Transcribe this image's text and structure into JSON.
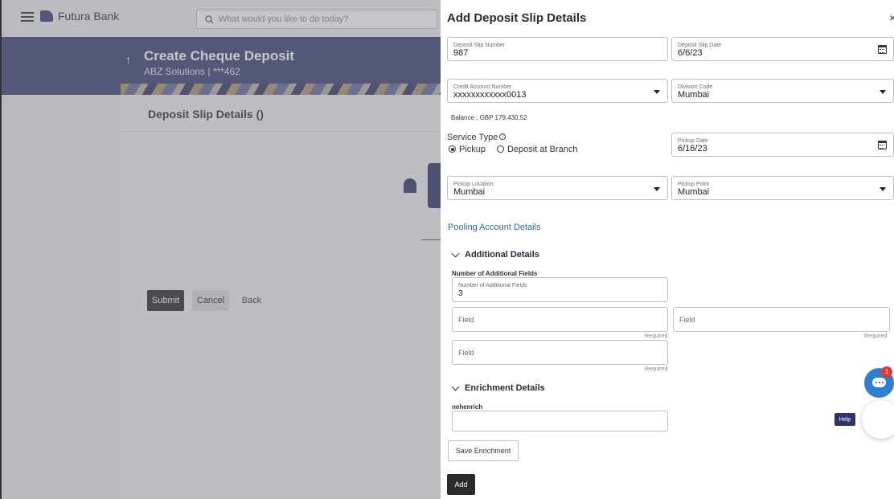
{
  "app": {
    "brand": "Futura Bank",
    "search_placeholder": "What would you like to do today?",
    "page_title": "Create Cheque Deposit",
    "page_subtitle": "ABZ Solutions | ***462",
    "card_title": "Deposit Slip Details ()",
    "buttons": {
      "submit": "Submit",
      "cancel": "Cancel",
      "back": "Back"
    }
  },
  "drawer": {
    "title": "Add Deposit Slip Details",
    "close": "×",
    "deposit_slip_number": {
      "label": "Deposit Slip Number",
      "value": "987"
    },
    "deposit_slip_date": {
      "label": "Deposit Slip Date",
      "value": "6/6/23"
    },
    "credit_account_number": {
      "label": "Credit Account Number",
      "value": "xxxxxxxxxxxx0013"
    },
    "division_code": {
      "label": "Division Code",
      "value": "Mumbai"
    },
    "balance": "Balance : GBP 179,430.52",
    "service_type": {
      "label": "Service Type",
      "info": "i",
      "options": [
        "Pickup",
        "Deposit at Branch"
      ],
      "selected": "Pickup"
    },
    "pickup_date": {
      "label": "Pickup Date",
      "value": "6/16/23"
    },
    "pickup_location": {
      "label": "Pickup Location",
      "value": "Mumbai"
    },
    "pickup_point": {
      "label": "Pickup Point",
      "value": "Mumbai"
    },
    "pooling_link": "Pooling Account Details",
    "additional": {
      "heading": "Additional Details",
      "count_label": "Number of Additional Fields",
      "count_field": {
        "label": "Number of Additional Fields",
        "value": "3"
      },
      "fields": [
        {
          "placeholder": "Field",
          "hint": "Required"
        },
        {
          "placeholder": "Field",
          "hint": "Required"
        },
        {
          "placeholder": "Field",
          "hint": "Required"
        }
      ]
    },
    "enrichment": {
      "heading": "Enrichment Details",
      "label": "nehenrich",
      "value": "",
      "save_label": "Save Enrichment"
    },
    "add_label": "Add",
    "help_label": "Help",
    "chat_badge": "1"
  }
}
